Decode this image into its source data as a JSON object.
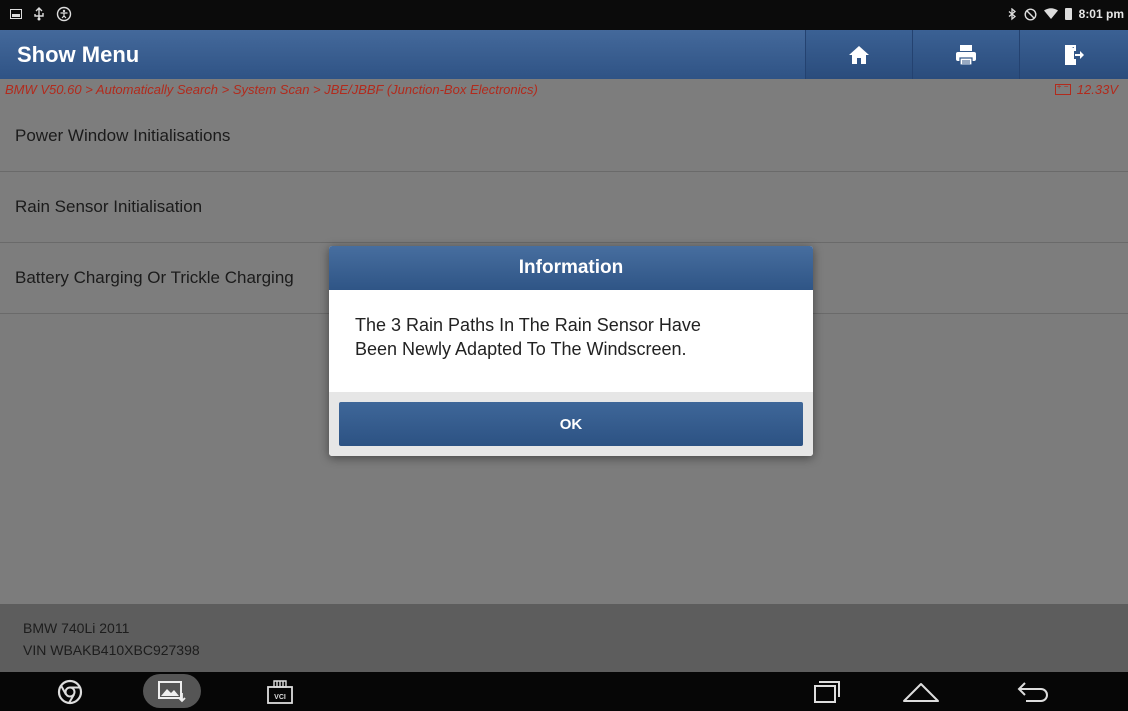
{
  "status_bar": {
    "time": "8:01 pm"
  },
  "header": {
    "title": "Show Menu",
    "buttons": [
      {
        "icon": "home-icon"
      },
      {
        "icon": "print-icon"
      },
      {
        "icon": "exit-icon"
      }
    ]
  },
  "breadcrumb": {
    "path": "BMW V50.60 > Automatically Search > System Scan > JBE/JBBF (Junction-Box Electronics)",
    "voltage": "12.33V",
    "color": "#b22a1c"
  },
  "menu": {
    "items": [
      {
        "label": "Power Window Initialisations"
      },
      {
        "label": "Rain Sensor Initialisation"
      },
      {
        "label": "Battery Charging Or Trickle Charging"
      }
    ]
  },
  "dialog": {
    "title": "Information",
    "message_line1": "The 3 Rain Paths In The Rain Sensor Have",
    "message_line2": "Been Newly Adapted To The Windscreen.",
    "ok_label": "OK"
  },
  "footer": {
    "vehicle": "BMW 740Li 2011",
    "vin": "VIN WBAKB410XBC927398"
  },
  "nav_bar": {
    "vci_label": "VCI",
    "icons": [
      "chrome-icon",
      "gallery-icon",
      "vci-icon",
      "recent-apps-icon",
      "home-nav-icon",
      "back-icon"
    ]
  },
  "colors": {
    "accent": "#2f5385",
    "overlay": "#7c7c7c"
  }
}
